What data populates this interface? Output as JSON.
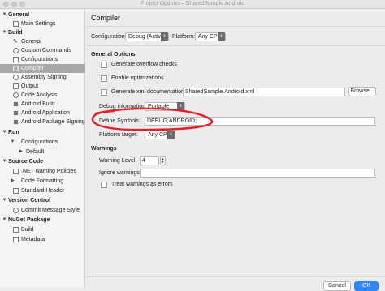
{
  "window": {
    "title": "Project Options – SharedSample.Android"
  },
  "sidebar": {
    "items": [
      {
        "label": "General",
        "section": true,
        "icon": "disclosure-triangle"
      },
      {
        "label": "Main Settings",
        "icon": "document-icon"
      },
      {
        "label": "Build",
        "section": true,
        "icon": "disclosure-triangle"
      },
      {
        "label": "General",
        "icon": "wrench-icon"
      },
      {
        "label": "Custom Commands",
        "icon": "gear-icon"
      },
      {
        "label": "Configurations",
        "icon": "document-icon"
      },
      {
        "label": "Compiler",
        "icon": "gear-icon",
        "selected": true
      },
      {
        "label": "Assembly Signing",
        "icon": "gear-icon"
      },
      {
        "label": "Output",
        "icon": "document-icon"
      },
      {
        "label": "Code Analysis",
        "icon": "gear-icon"
      },
      {
        "label": "Android Build",
        "icon": "square-icon"
      },
      {
        "label": "Android Application",
        "icon": "square-icon"
      },
      {
        "label": "Android Package Signing",
        "icon": "square-icon"
      },
      {
        "label": "Run",
        "section": true,
        "icon": "disclosure-triangle"
      },
      {
        "label": "Configurations",
        "icon": "disclosure-triangle"
      },
      {
        "label": "Default",
        "icon": "play-icon"
      },
      {
        "label": "Source Code",
        "section": true,
        "icon": "disclosure-triangle"
      },
      {
        "label": ".NET Naming Policies",
        "icon": "document-icon"
      },
      {
        "label": "Code Formatting",
        "icon": "disclosure-triangle"
      },
      {
        "label": "Standard Header",
        "icon": "document-icon"
      },
      {
        "label": "Version Control",
        "section": true,
        "icon": "disclosure-triangle"
      },
      {
        "label": "Commit Message Style",
        "icon": "gear-icon"
      },
      {
        "label": "NuGet Package",
        "section": true,
        "icon": "disclosure-triangle"
      },
      {
        "label": "Build",
        "icon": "document-icon"
      },
      {
        "label": "Metadata",
        "icon": "document-icon"
      }
    ]
  },
  "main": {
    "title": "Compiler",
    "configuration_label": "Configuration:",
    "configuration_value": "Debug (Active)",
    "platform_label": "Platform:",
    "platform_value": "Any CPU",
    "general_options_heading": "General Options",
    "generate_overflow_checks": "Generate overflow checks",
    "enable_optimizations": "Enable optimizations",
    "generate_xml_doc": "Generate xml documentation:",
    "xml_doc_value": "SharedSample.Android.xml",
    "browse_label": "Browse...",
    "debug_information_label": "Debug information:",
    "debug_information_value": "Portable",
    "define_symbols_label": "Define Symbols:",
    "define_symbols_value": "DEBUG;ANDROID;",
    "platform_target_label": "Platform target:",
    "platform_target_value": "Any CPU",
    "warnings_heading": "Warnings",
    "warning_level_label": "Warning Level:",
    "warning_level_value": "4",
    "ignore_warnings_label": "Ignore warnings:",
    "ignore_warnings_value": "",
    "treat_warnings_as_errors": "Treat warnings as errors",
    "cancel_label": "Cancel",
    "ok_label": "OK"
  },
  "colors": {
    "annotation": "#e0202a",
    "accent": "#2f86f6",
    "selection": "#a9a9a9"
  }
}
